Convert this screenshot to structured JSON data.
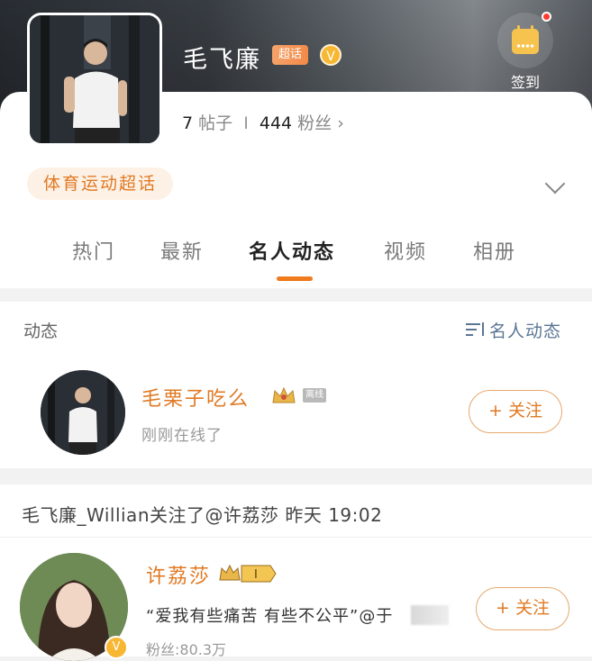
{
  "header": {
    "title": "毛飞廉",
    "chaohua_badge": "超话",
    "checkin_label": "签到"
  },
  "stats": {
    "posts_num": "7",
    "posts_label": "帖子",
    "fans_num": "444",
    "fans_label": "粉丝",
    "chevron": "›"
  },
  "tag": "体育运动超话",
  "tabs": [
    {
      "label": "热门",
      "active": false
    },
    {
      "label": "最新",
      "active": false
    },
    {
      "label": "名人动态",
      "active": true
    },
    {
      "label": "视频",
      "active": false
    },
    {
      "label": "相册",
      "active": false
    }
  ],
  "dynamics": {
    "title": "动态",
    "filter": "名人动态",
    "user": {
      "name": "毛栗子吃么",
      "badge": "离线",
      "status": "刚刚在线了",
      "follow": "+ 关注"
    }
  },
  "activity": {
    "text": "毛飞廉_Willian关注了@许荔莎 昨天 19:02",
    "user": {
      "name": "许荔莎",
      "level": "I",
      "quote": "“爱我有些痛苦 有些不公平”@于",
      "fans": "粉丝:80.3万",
      "follow": "+ 关注"
    }
  },
  "colors": {
    "accent": "#e07a24",
    "link_blue": "#5a7694",
    "underline": "#ef7b1c"
  }
}
